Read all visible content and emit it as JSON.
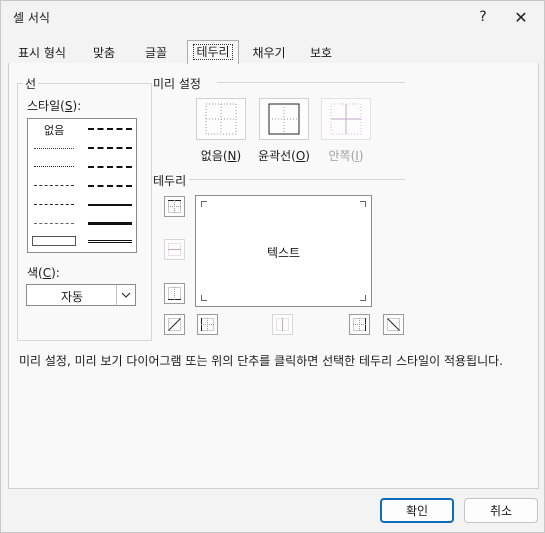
{
  "window": {
    "title": "셀 서식",
    "help_label": "?",
    "close_label": "✕"
  },
  "tabs": [
    {
      "label": "표시 형식"
    },
    {
      "label": "맞춤"
    },
    {
      "label": "글꼴"
    },
    {
      "label": "테두리",
      "active": true
    },
    {
      "label": "채우기"
    },
    {
      "label": "보호"
    }
  ],
  "line_section": {
    "title": "선",
    "style_label": "스타일(S):",
    "none_label": "없음",
    "color_label": "색(C):",
    "color_value": "자동"
  },
  "presets": {
    "title": "미리 설정",
    "items": [
      {
        "label": "없음(N)"
      },
      {
        "label": "윤곽선(O)"
      },
      {
        "label": "안쪽(I)",
        "disabled": true
      }
    ]
  },
  "border_section": {
    "title": "테두리",
    "preview_text": "텍스트"
  },
  "description": "미리 설정, 미리 보기 다이어그램 또는 위의 단추를 클릭하면 선택한 테두리 스타일이 적용됩니다.",
  "buttons": {
    "ok": "확인",
    "cancel": "취소"
  }
}
